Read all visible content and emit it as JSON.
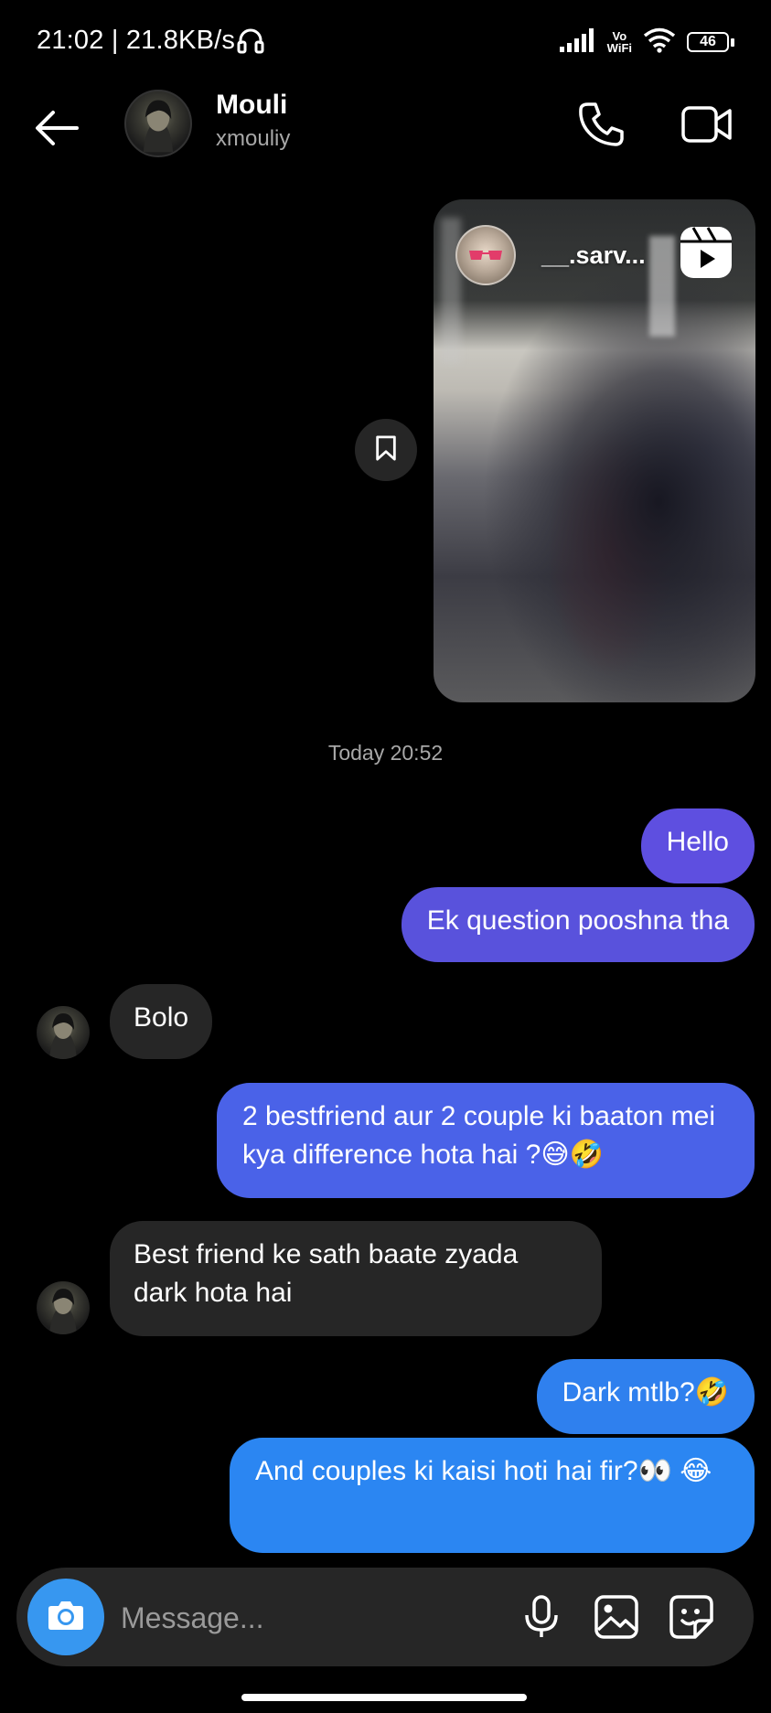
{
  "status_bar": {
    "time": "21:02 | 21.8KB/s",
    "vowifi": "Vo\nWiFi",
    "battery": "46"
  },
  "header": {
    "name": "Mouli",
    "username": "xmouliy"
  },
  "reel": {
    "username": "__.sarv..."
  },
  "timestamp": "Today 20:52",
  "messages": [
    {
      "side": "out",
      "text": "Hello"
    },
    {
      "side": "out",
      "text": "Ek question pooshna tha"
    },
    {
      "side": "in",
      "text": "Bolo"
    },
    {
      "side": "out",
      "text": "2 bestfriend aur 2 couple ki baaton mei kya difference hota hai ?😅🤣"
    },
    {
      "side": "in",
      "text": "Best friend ke sath baate zyada dark hota hai"
    },
    {
      "side": "out",
      "text": "Dark mtlb?🤣"
    },
    {
      "side": "out",
      "text": "And couples ki kaisi hoti hai fir?👀 😂"
    }
  ],
  "composer": {
    "placeholder": "Message..."
  },
  "colors": {
    "outgoing_purple": "#5b51d8",
    "outgoing_blue": "#3797f0",
    "incoming": "#262626",
    "camera_button": "#3797f0"
  }
}
